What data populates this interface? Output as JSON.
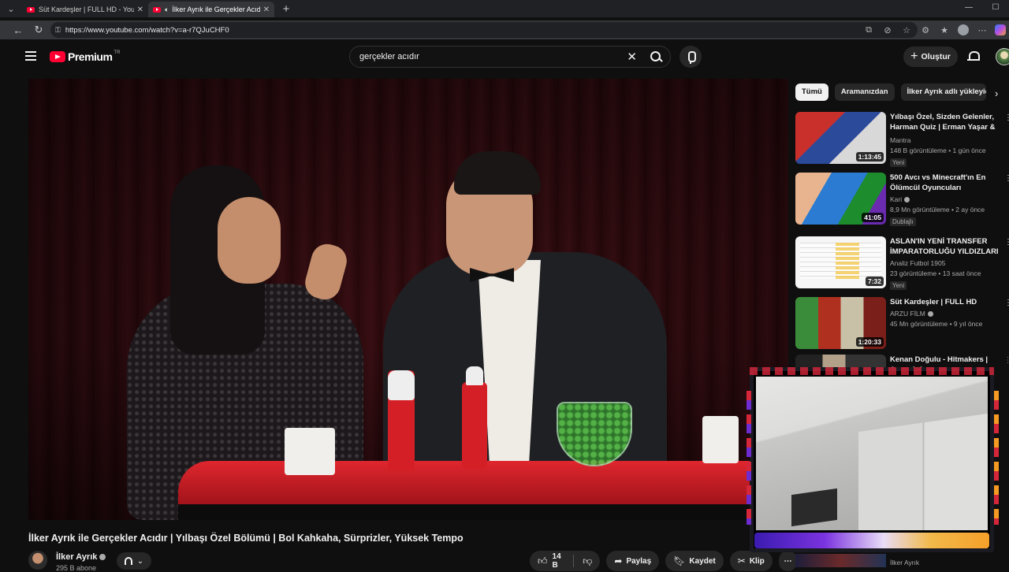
{
  "browser": {
    "tabs": [
      {
        "title": "Süt Kardeşler | FULL HD - YouTube",
        "active": false
      },
      {
        "title": "İlker Ayrık ile Gerçekler Acıdır",
        "active": true,
        "audio": true
      }
    ],
    "url": "https://www.youtube.com/watch?v=a-r7QJuCHF0"
  },
  "header": {
    "logo_text": "Premium",
    "logo_country": "TR",
    "search_value": "gerçekler acıdır",
    "create_label": "Oluştur"
  },
  "video": {
    "title": "İlker Ayrık ile Gerçekler Acıdır | Yılbaşı Özel Bölümü | Bol Kahkaha, Sürprizler, Yüksek Tempo",
    "channel": "İlker Ayrık",
    "subscribers": "295 B abone",
    "likes": "14 B",
    "share_label": "Paylaş",
    "save_label": "Kaydet",
    "clip_label": "Klip"
  },
  "sidebar": {
    "chips": [
      "Tümü",
      "Aramanızdan",
      "İlker Ayrık adlı yükleyiciden"
    ],
    "recommendations": [
      {
        "title": "Yılbaşı Özel, Sizden Gelenler, Harman Quiz | Erman Yaşar & ...",
        "channel": "Mantra",
        "verified": false,
        "stats": "148 B görüntüleme • 1 gün önce",
        "badge": "Yeni",
        "duration": "1:13:45"
      },
      {
        "title": "500 Avcı vs Minecraft'ın En Ölümcül Oyuncuları",
        "channel": "Kari",
        "verified": true,
        "stats": "8,9 Mn görüntüleme • 2 ay önce",
        "badge": "Dublajlı",
        "duration": "41:05"
      },
      {
        "title": "ASLAN'IN YENİ TRANSFER İMPARATORLUĞU YILDIZLARI",
        "channel": "Analiz Futbol 1905",
        "verified": false,
        "stats": "23 görüntüleme • 13 saat önce",
        "badge": "Yeni",
        "duration": "7:32"
      },
      {
        "title": "Süt Kardeşler | FULL HD",
        "channel": "ARZU FİLM",
        "verified": true,
        "stats": "45 Mn görüntüleme • 9 yıl önce",
        "badge": "",
        "duration": "1:20:33"
      },
      {
        "title": "Kenan Doğulu - Hitmakers | Arem & Arman",
        "channel": "",
        "verified": false,
        "stats": "",
        "badge": "",
        "duration": ""
      }
    ],
    "bottom_partial_channel": "İlker Ayrık"
  }
}
